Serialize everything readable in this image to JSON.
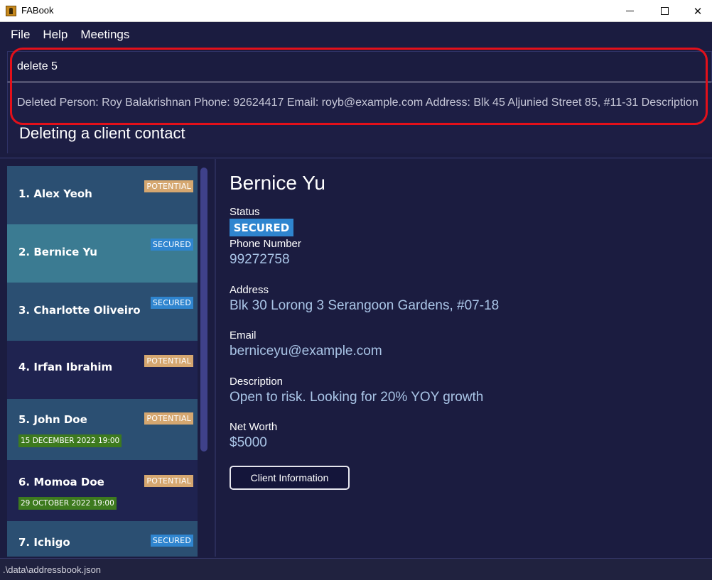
{
  "window": {
    "title": "FABook",
    "icon": "fabook-app-icon",
    "controls": [
      "minimize-icon",
      "maximize-icon",
      "close-icon"
    ]
  },
  "menu": {
    "items": [
      "File",
      "Help",
      "Meetings"
    ]
  },
  "command": {
    "input_value": "delete 5",
    "result": "Deleted Person: Roy Balakrishnan Phone: 92624417 Email: royb@example.com Address: Blk 45 Aljunied Street 85, #11-31 Description"
  },
  "annotation": {
    "label": "Deleting a client contact",
    "color": "#e3101a"
  },
  "people": [
    {
      "index": "1.",
      "name": "Alex Yeoh",
      "tag": "POTENTIAL",
      "meeting": ""
    },
    {
      "index": "2.",
      "name": "Bernice Yu",
      "tag": "SECURED",
      "meeting": ""
    },
    {
      "index": "3.",
      "name": "Charlotte Oliveiro",
      "tag": "SECURED",
      "meeting": ""
    },
    {
      "index": "4.",
      "name": "Irfan Ibrahim",
      "tag": "POTENTIAL",
      "meeting": ""
    },
    {
      "index": "5.",
      "name": "John Doe",
      "tag": "POTENTIAL",
      "meeting": "15 DECEMBER 2022 19:00"
    },
    {
      "index": "6.",
      "name": "Momoa Doe",
      "tag": "POTENTIAL",
      "meeting": "29 OCTOBER 2022 19:00"
    },
    {
      "index": "7.",
      "name": "Ichigo",
      "tag": "SECURED",
      "meeting": ""
    }
  ],
  "detail": {
    "name": "Bernice Yu",
    "status_label": "Status",
    "status": "SECURED",
    "phone_label": "Phone Number",
    "phone": "99272758",
    "address_label": "Address",
    "address": "Blk 30 Lorong 3 Serangoon Gardens, #07-18",
    "email_label": "Email",
    "email": "berniceyu@example.com",
    "description_label": "Description",
    "description": "Open to risk. Looking for 20% YOY growth",
    "networth_label": "Net Worth",
    "networth": "$5000",
    "client_info_button": "Client Information"
  },
  "status_bar": {
    "path": ".\\data\\addressbook.json"
  },
  "colors": {
    "background": "#1b1c40",
    "selected_card": "#3b7b92",
    "card_blue": "#2b4f72",
    "card_dark": "#1f2350",
    "tag_potential": "#d5a770",
    "tag_secured": "#2f85cf",
    "meeting_badge": "#3d7a1e",
    "accent_text": "#a9c4e6"
  }
}
